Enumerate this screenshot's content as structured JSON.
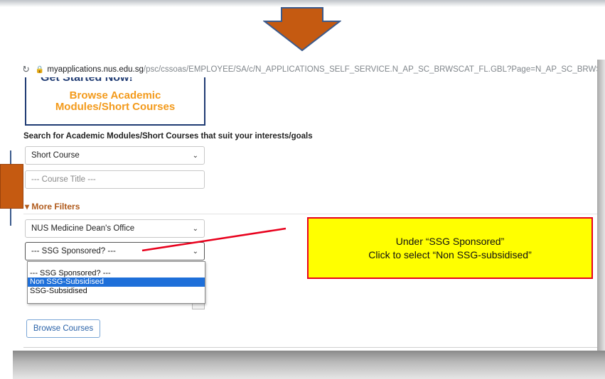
{
  "browser": {
    "back_icon": "arrow-left-icon",
    "forward_icon": "arrow-right-icon",
    "reload_icon": "reload-icon",
    "lock_icon": "lock-icon",
    "url_host": "myapplications.nus.edu.sg",
    "url_path": "/psc/cssoas/EMPLOYEE/SA/c/N_APPLICATIONS_SELF_SERVICE.N_AP_SC_BRWSCAT_FL.GBL?Page=N_AP_SC_BRWSC"
  },
  "promo": {
    "cut_text": "Get Started Now!",
    "line1": "Browse Academic",
    "line2": "Modules/Short Courses"
  },
  "search": {
    "heading": "Search for Academic Modules/Short Courses that suit your interests/goals",
    "type_value": "Short Course",
    "title_placeholder": "--- Course Title ---",
    "more_filters": "More Filters",
    "more_filters_icon": "caret-down-icon",
    "department_value": "NUS Medicine Dean's Office",
    "ssg_value": "--- SSG Sponsored? ---",
    "ssg_options": [
      "--- SSG Sponsored? ---",
      "Non SSG-Subsidised",
      "SSG-Subsidised"
    ],
    "ssg_selected_index": 1,
    "browse_button": "Browse Courses"
  },
  "callout": {
    "line1": "Under “SSG Sponsored”",
    "line2": "Click to select “Non SSG-subsidised”"
  },
  "colors": {
    "arrow_fill": "#c55a11",
    "arrow_border": "#3b5a8c",
    "promo_text": "#f39a1b",
    "promo_border": "#1f3b73",
    "more_filters": "#b05a1b",
    "callout_bg": "#ffff00",
    "callout_border": "#e8001c",
    "selection_blue": "#1e6fd9"
  }
}
